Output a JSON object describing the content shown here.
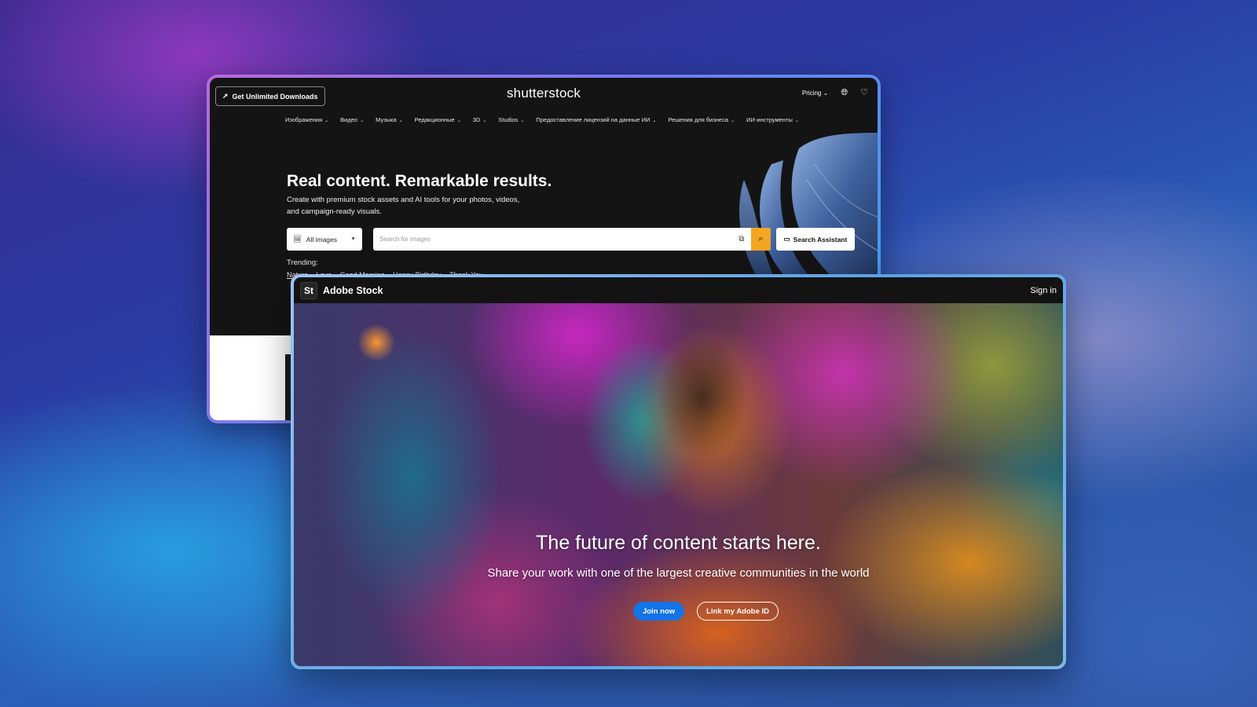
{
  "shutterstock": {
    "unlimited_label": "Get Unlimited Downloads",
    "logo": "shutterstock",
    "pricing_label": "Pricing",
    "icons": {
      "rocket": "rocket-icon",
      "globe": "globe-icon",
      "heart": "heart-icon",
      "image": "image-icon",
      "camera": "image-search-icon",
      "search": "search-icon",
      "assistant": "chat-icon"
    },
    "nav": [
      "Изображения",
      "Видео",
      "Музыка",
      "Редакционные",
      "3D",
      "Studios",
      "Предоставление лицензий на данные ИИ",
      "Решения для бизнеса",
      "ИИ-инструменты"
    ],
    "hero_title": "Real content. Remarkable results.",
    "hero_subtitle": "Create with premium stock assets and AI tools for your photos, videos, and campaign-ready visuals.",
    "type_selector": "All images",
    "search_placeholder": "Search for images",
    "assistant_label": "Search Assistant",
    "trending_label": "Trending:",
    "trending_items": [
      "Nature",
      "Love",
      "Good Morning",
      "Happy Birthday",
      "Thank You"
    ],
    "colors": {
      "search_button": "#f5a524",
      "background": "#141414"
    }
  },
  "adobe": {
    "logo_mark": "St",
    "brand": "Adobe Stock",
    "signin": "Sign in",
    "headline": "The future of content starts here.",
    "subline": "Share your work with one of the largest creative communities in the world",
    "join_label": "Join now",
    "link_label": "Link my Adobe ID",
    "colors": {
      "join_button": "#1473e6"
    }
  }
}
